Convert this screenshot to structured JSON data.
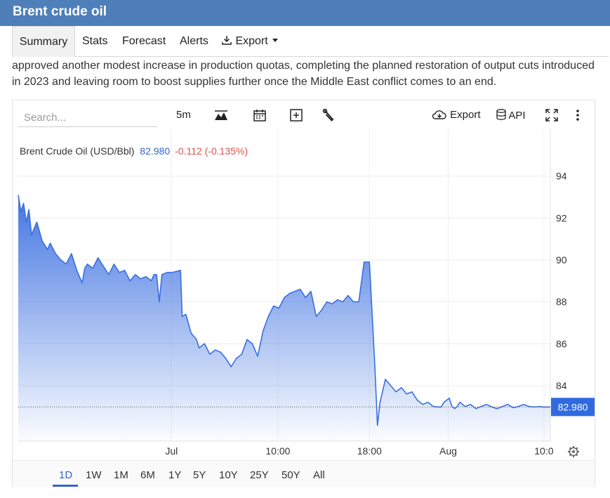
{
  "header": {
    "title": "Brent crude oil"
  },
  "tabs": [
    {
      "label": "Summary",
      "active": true
    },
    {
      "label": "Stats"
    },
    {
      "label": "Forecast"
    },
    {
      "label": "Alerts"
    },
    {
      "label": "Export"
    }
  ],
  "article": {
    "line1": "approved another modest increase in production quotas, completing the planned restoration of output cuts introduced",
    "line2": "in 2023 and leaving room to boost supplies further once the Middle East conflict comes to an end."
  },
  "toolbar": {
    "search_placeholder": "Search...",
    "interval": "5m",
    "export_label": "Export",
    "api_label": "API"
  },
  "chart_legend": {
    "name": "Brent Crude Oil (USD/Bbl)",
    "price": "82.980",
    "change": "-0.112 (-0.135%)"
  },
  "ranges": [
    "1D",
    "1W",
    "1M",
    "6M",
    "1Y",
    "5Y",
    "10Y",
    "25Y",
    "50Y",
    "All"
  ],
  "active_range": "1D",
  "colors": {
    "line": "#3a6fe0",
    "down": "#d9534f",
    "accent": "#3366cc",
    "header": "#4f7fb8"
  },
  "chart_data": {
    "type": "area",
    "title": "Brent Crude Oil (USD/Bbl)",
    "xlabel": "",
    "ylabel": "",
    "x_tick_labels": [
      "Jul",
      "10:00",
      "18:00",
      "Aug",
      "10:0"
    ],
    "x_tick_positions": [
      0.288,
      0.488,
      0.66,
      0.808,
      0.988
    ],
    "yticks": [
      84,
      86,
      88,
      90,
      92,
      94
    ],
    "ylim": [
      81.35,
      95.6
    ],
    "last_value": 82.98,
    "last_label": "82.980",
    "grid": true,
    "x": [
      0,
      0.005,
      0.01,
      0.015,
      0.02,
      0.025,
      0.035,
      0.045,
      0.055,
      0.06,
      0.07,
      0.08,
      0.09,
      0.1,
      0.11,
      0.12,
      0.125,
      0.13,
      0.14,
      0.15,
      0.16,
      0.17,
      0.18,
      0.19,
      0.2,
      0.21,
      0.22,
      0.23,
      0.24,
      0.25,
      0.255,
      0.26,
      0.265,
      0.27,
      0.28,
      0.29,
      0.305,
      0.308,
      0.315,
      0.325,
      0.335,
      0.34,
      0.35,
      0.36,
      0.37,
      0.38,
      0.39,
      0.4,
      0.41,
      0.42,
      0.43,
      0.44,
      0.45,
      0.46,
      0.47,
      0.48,
      0.49,
      0.5,
      0.51,
      0.52,
      0.53,
      0.54,
      0.55,
      0.56,
      0.57,
      0.58,
      0.59,
      0.6,
      0.61,
      0.62,
      0.63,
      0.64,
      0.65,
      0.66,
      0.67,
      0.675,
      0.68,
      0.69,
      0.7,
      0.71,
      0.72,
      0.73,
      0.74,
      0.75,
      0.76,
      0.77,
      0.78,
      0.79,
      0.795,
      0.8,
      0.81,
      0.815,
      0.82,
      0.825,
      0.83,
      0.84,
      0.85,
      0.86,
      0.87,
      0.88,
      0.89,
      0.9,
      0.91,
      0.92,
      0.93,
      0.94,
      0.95,
      0.96,
      0.97,
      0.98,
      0.985,
      0.99,
      1.0
    ],
    "values": [
      93.1,
      92.3,
      92.7,
      91.8,
      92.4,
      91.2,
      91.8,
      90.9,
      90.5,
      90.8,
      90.3,
      90.0,
      89.8,
      90.3,
      89.5,
      88.9,
      89.6,
      89.8,
      89.6,
      90.1,
      89.7,
      89.3,
      89.8,
      89.4,
      89.5,
      89.0,
      89.3,
      89.1,
      89.2,
      89.0,
      89.3,
      89.3,
      88.0,
      89.3,
      89.4,
      89.4,
      89.5,
      87.3,
      87.4,
      86.5,
      86.2,
      85.8,
      86.0,
      85.5,
      85.7,
      85.6,
      85.3,
      84.9,
      85.3,
      85.5,
      86.2,
      86.0,
      85.4,
      86.6,
      87.3,
      87.8,
      87.7,
      88.2,
      88.4,
      88.5,
      88.6,
      88.2,
      88.5,
      87.3,
      87.6,
      88.0,
      87.9,
      88.1,
      88.0,
      88.3,
      88.0,
      88.0,
      89.9,
      89.9,
      85.0,
      82.1,
      83.2,
      84.3,
      84.0,
      83.7,
      83.9,
      83.6,
      83.7,
      83.3,
      83.1,
      83.2,
      83.0,
      82.98,
      82.98,
      83.2,
      83.4,
      83.0,
      82.9,
      83.0,
      83.2,
      83.0,
      83.1,
      82.9,
      83.0,
      83.1,
      82.98,
      82.9,
      83.0,
      83.1,
      82.95,
      83.0,
      83.1,
      83.0,
      82.98,
      83.0,
      82.98,
      82.98,
      82.98
    ]
  }
}
